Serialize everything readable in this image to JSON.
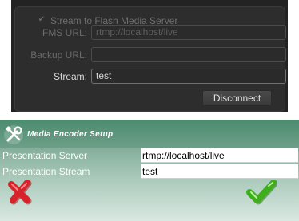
{
  "stream_panel": {
    "stream_checkbox_label": "Stream to Flash Media Server",
    "stream_checked": true,
    "fms_url_label": "FMS URL:",
    "fms_url_value": "rtmp://localhost/live",
    "backup_url_label": "Backup URL:",
    "backup_url_value": "",
    "stream_label": "Stream:",
    "stream_value": "test",
    "disconnect_label": "Disconnect"
  },
  "encoder_dialog": {
    "title": "Media Encoder Setup",
    "server_label": "Presentation Server",
    "server_value": "rtmp://localhost/live",
    "stream_label": "Presentation Stream",
    "stream_value": "test"
  },
  "colors": {
    "panel_bg": "#232323",
    "dialog_green": "#4f8f72",
    "cancel_red": "#d8232a",
    "ok_green": "#3fae1c"
  }
}
